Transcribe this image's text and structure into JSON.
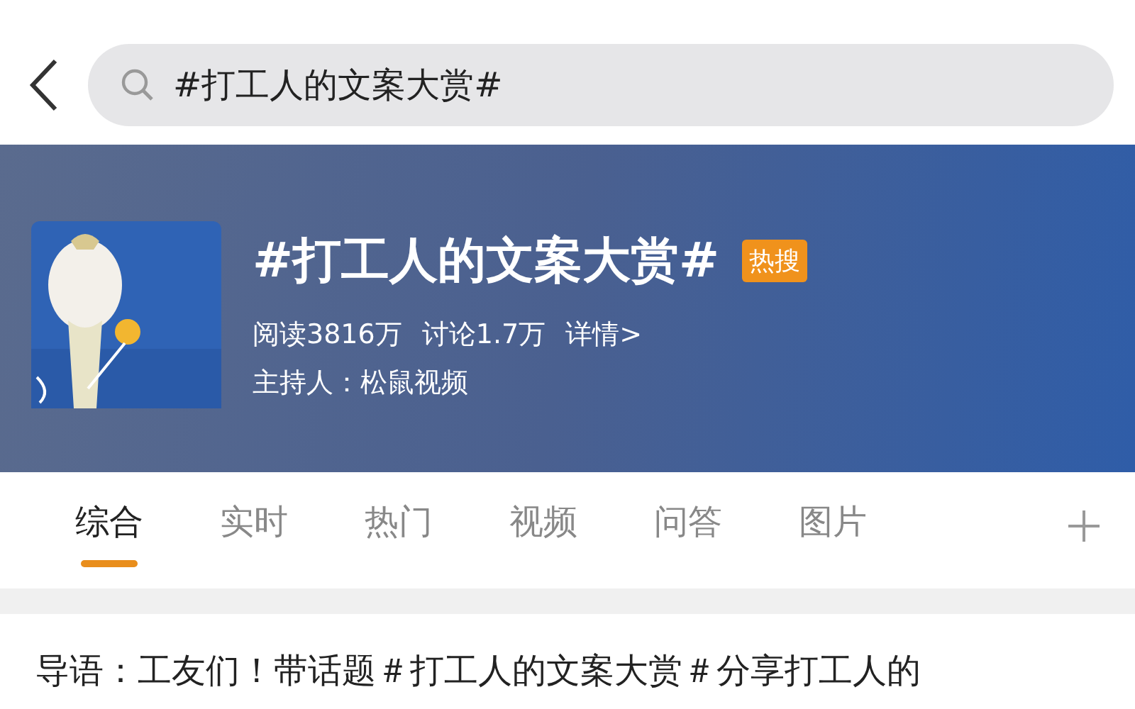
{
  "search": {
    "value": "#打工人的文案大赏#"
  },
  "topic": {
    "title": "#打工人的文案大赏#",
    "badge": "热搜",
    "stats": [
      "阅读3816万",
      "讨论1.7万",
      "详情>"
    ],
    "host": "主持人：松鼠视频"
  },
  "tabs": [
    {
      "label": "综合",
      "selected": true
    },
    {
      "label": "实时",
      "selected": false
    },
    {
      "label": "热门",
      "selected": false
    },
    {
      "label": "视频",
      "selected": false
    },
    {
      "label": "问答",
      "selected": false
    },
    {
      "label": "图片",
      "selected": false
    }
  ],
  "intro": "导语：工友们！带话题＃打工人的文案大赏＃分享打工人的"
}
